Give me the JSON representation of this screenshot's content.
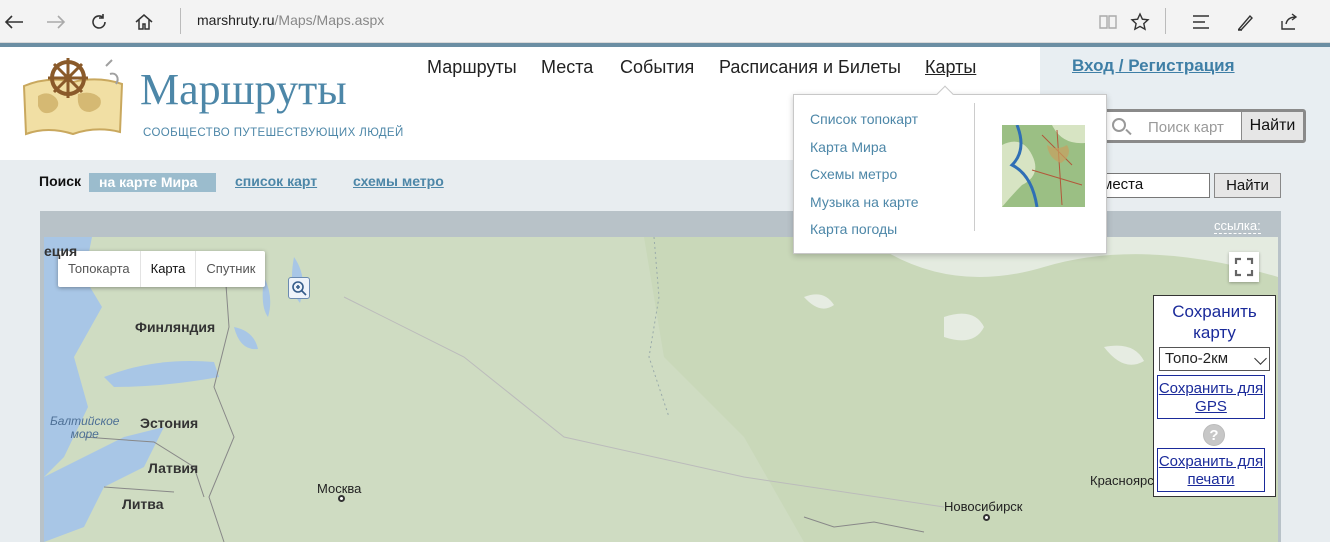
{
  "browser": {
    "url_host": "marshruty.ru",
    "url_path": "/Maps/Maps.aspx",
    "nav_icons": [
      "back-arrow-icon",
      "forward-arrow-icon",
      "refresh-icon",
      "home-icon"
    ],
    "toolbar_icons": [
      "reading-view-icon",
      "favorite-star-icon",
      "hub-icon",
      "web-note-icon",
      "share-icon"
    ]
  },
  "site": {
    "logo_text": "Маршруты",
    "logo_subtitle": "СООБЩЕСТВО ПУТЕШЕСТВУЮЩИХ ЛЮДЕЙ",
    "menu": [
      "Маршруты",
      "Места",
      "События",
      "Расписания и Билеты",
      "Карты"
    ],
    "login": "Вход / Регистрация",
    "search_placeholder": "Поиск карт",
    "search_button": "Найти"
  },
  "dropdown": {
    "items": [
      "Список топокарт",
      "Карта Мира",
      "Схемы метро",
      "Музыка на карте",
      "Карта погоды"
    ]
  },
  "subnav": {
    "search_label": "Поиск",
    "tabs": [
      "на карте Мира",
      "список карт",
      "схемы метро"
    ],
    "place_value": "места",
    "place_button": "Найти"
  },
  "map": {
    "link_label": "ссылка:",
    "types": [
      "Топокарта",
      "Карта",
      "Спутник"
    ],
    "selected_type": "Карта",
    "labels": {
      "sweden_partial": "еция",
      "finland": "Финляндия",
      "baltic_sea": [
        "Балтийское",
        "море"
      ],
      "estonia": "Эстония",
      "latvia": "Латвия",
      "lithuania": "Литва",
      "moscow": "Москва",
      "novosibirsk": "Новосибирск",
      "krasnoyarsk": "Красноярс"
    }
  },
  "save_panel": {
    "title": "Сохранить карту",
    "select_value": "Топо-2км",
    "gps_button": "Сохранить для GPS",
    "print_button": "Сохранить для печати",
    "help": "?"
  },
  "colors": {
    "brand_blue": "#4d87a8",
    "header_accent": "#6b8ea3",
    "active_tab": "#9bbccd",
    "save_text": "#1a2a9a",
    "map_land": "#cfdcc2",
    "map_water": "#a8c6e6"
  }
}
